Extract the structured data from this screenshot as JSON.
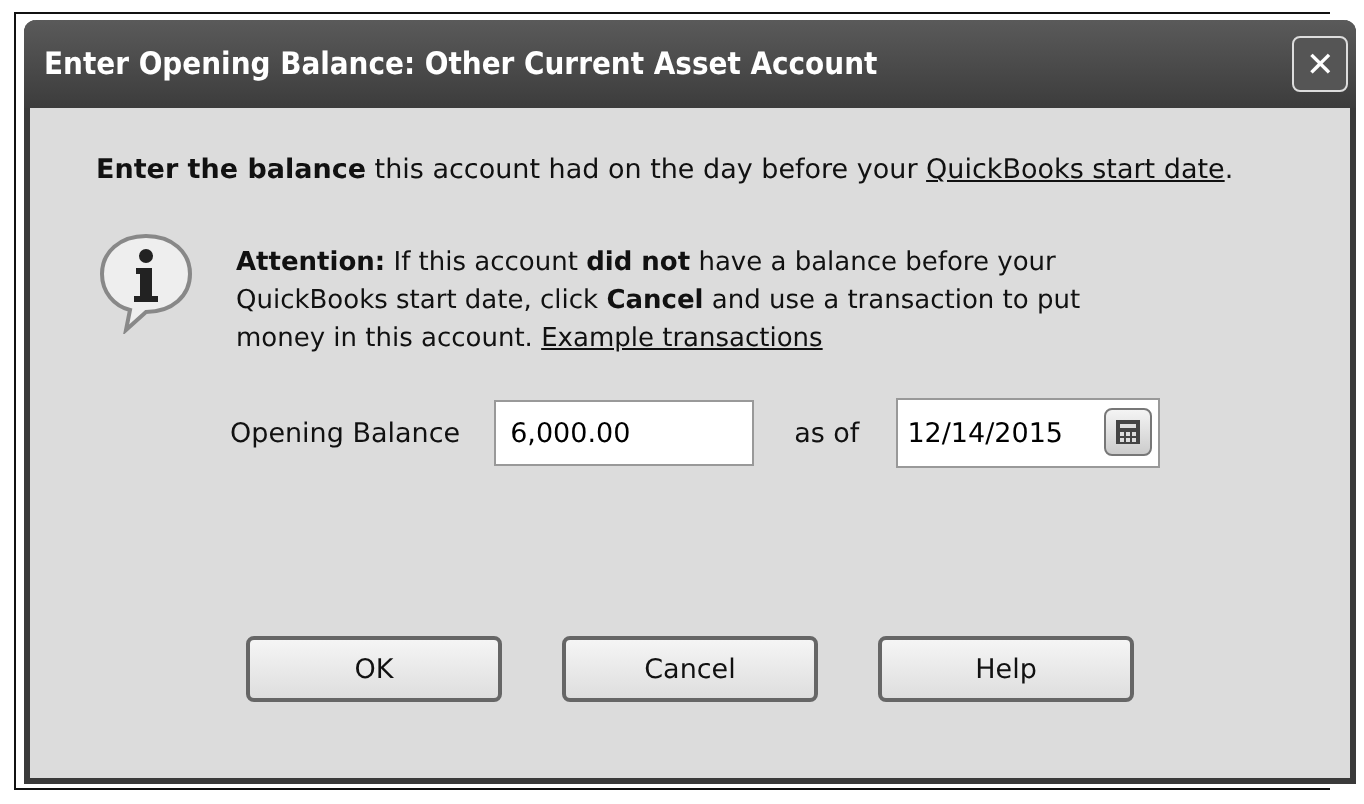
{
  "window": {
    "title": "Enter Opening Balance: Other Current Asset Account",
    "close": "✕"
  },
  "intro": {
    "text": "**Enter the balance** this account had on the day before your ",
    "link": "QuickBooks start date",
    "tail": "."
  },
  "attention": {
    "text": "**Attention:** If this account **did not** have a balance before your QuickBooks start date, click **Cancel** and use a transaction to put money in this account. ",
    "link": "Example transactions"
  },
  "fields": {
    "balance_label": "Opening Balance",
    "balance_value": "6,000.00",
    "date_label": "as of",
    "date_value": "12/14/2015"
  },
  "buttons": [
    "OK",
    "Cancel",
    "Help"
  ]
}
